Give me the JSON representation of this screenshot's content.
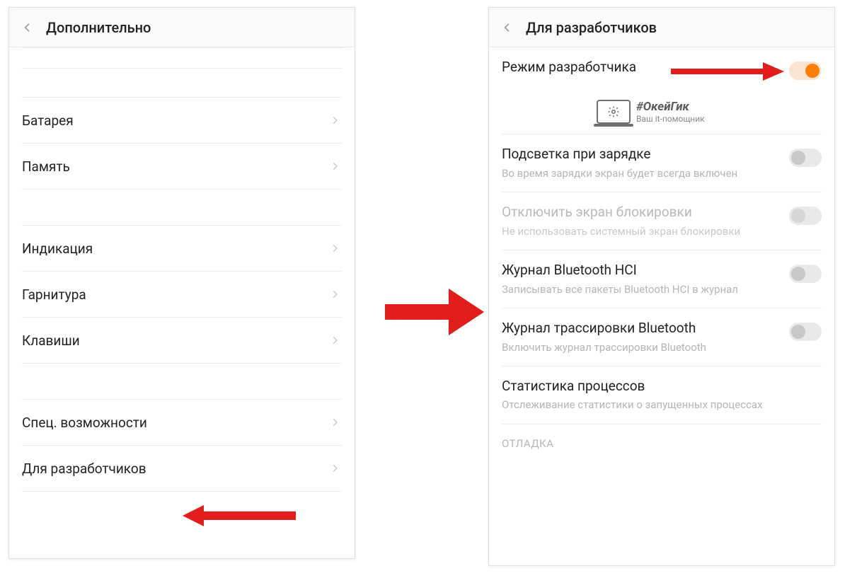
{
  "left": {
    "header_title": "Дополнительно",
    "items": {
      "battery": "Батарея",
      "memory": "Память",
      "indication": "Индикация",
      "headset": "Гарнитура",
      "keys": "Клавиши",
      "accessibility": "Спец. возможности",
      "developer": "Для разработчиков"
    }
  },
  "right": {
    "header_title": "Для разработчиков",
    "dev_mode": {
      "title": "Режим разработчика",
      "on": true
    },
    "backlight": {
      "title": "Подсветка при зарядке",
      "sub": "Во время зарядки экран будет всегда включен",
      "on": false
    },
    "disable_lock": {
      "title": "Отключить экран блокировки",
      "sub": "Не использовать системный экран блокировки",
      "on": false,
      "disabled": true
    },
    "bt_hci": {
      "title": "Журнал Bluetooth HCI",
      "sub": "Записывать все пакеты Bluetooth HCI в журнал",
      "on": false
    },
    "bt_trace": {
      "title": "Журнал трассировки Bluetooth",
      "sub": "Включить журнал трассировки Bluetooth",
      "on": false
    },
    "proc_stats": {
      "title": "Статистика процессов",
      "sub": "Отслеживание статистики о запущенных процессах"
    },
    "section_debug": "ОТЛАДКА"
  },
  "watermark": {
    "line1": "#ОкейГик",
    "line2": "Ваш it-помощник"
  }
}
